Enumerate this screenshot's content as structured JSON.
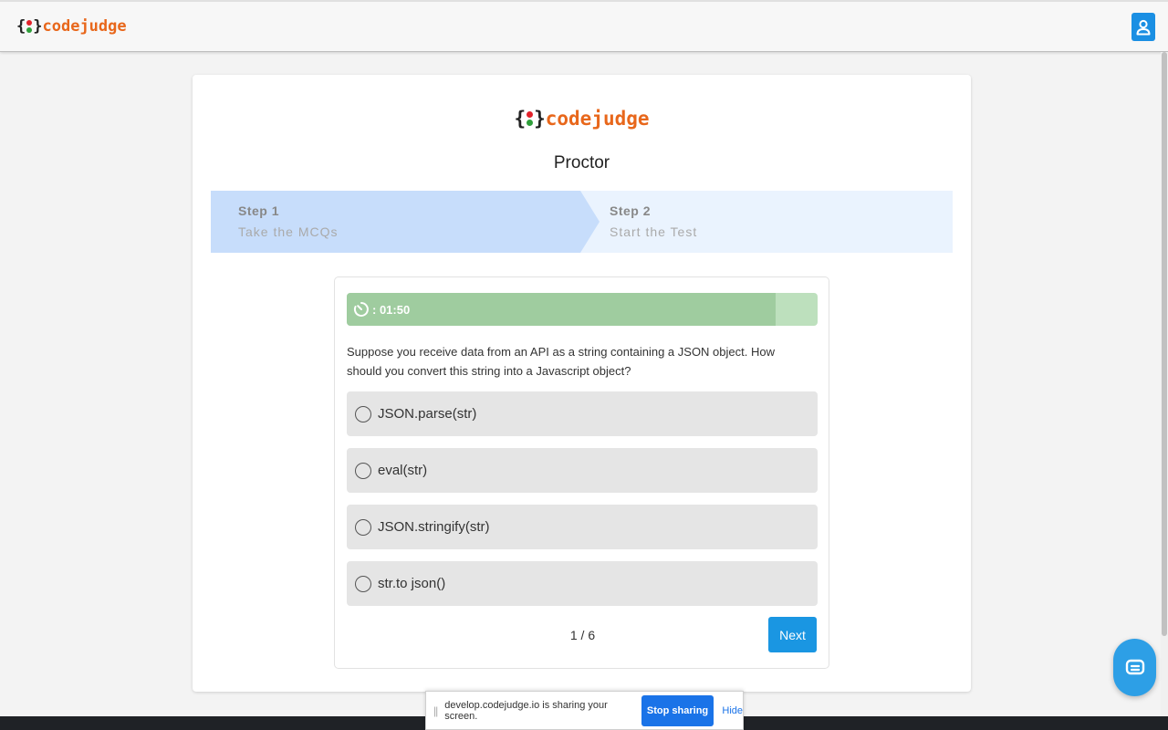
{
  "header": {
    "brand": {
      "open": "{",
      "close": "}",
      "name": "codejudge"
    }
  },
  "colors": {
    "accent": "#1a96e2",
    "brand_text": "#e8671b",
    "dot_red": "#e2222a",
    "dot_green": "#2e9e3a",
    "timer_fill": "#9fcc9f",
    "timer_track": "#bde0bd",
    "step_active": "#c7ddfb",
    "step_inactive": "#eaf3fe"
  },
  "main": {
    "brand": {
      "open": "{",
      "close": "}",
      "name": "codejudge"
    },
    "title": "Proctor",
    "steps": [
      {
        "title": "Step 1",
        "subtitle": "Take the MCQs",
        "active": true
      },
      {
        "title": "Step 2",
        "subtitle": "Start the Test",
        "active": false
      }
    ]
  },
  "quiz": {
    "timer_label": ": 01:50",
    "timer_progress": 0.91,
    "question": "Suppose you receive data from an API as a string containing a JSON object. How should you convert this string into a Javascript object?",
    "options": [
      {
        "label": "JSON.parse(str)"
      },
      {
        "label": "eval(str)"
      },
      {
        "label": "JSON.stringify(str)"
      },
      {
        "label": "str.to json()"
      }
    ],
    "page_indicator": "1 / 6",
    "next_label": "Next"
  },
  "share_bar": {
    "grip": "||",
    "message": "develop.codejudge.io is sharing your screen.",
    "stop_label": "Stop sharing",
    "hide_label": "Hide"
  }
}
